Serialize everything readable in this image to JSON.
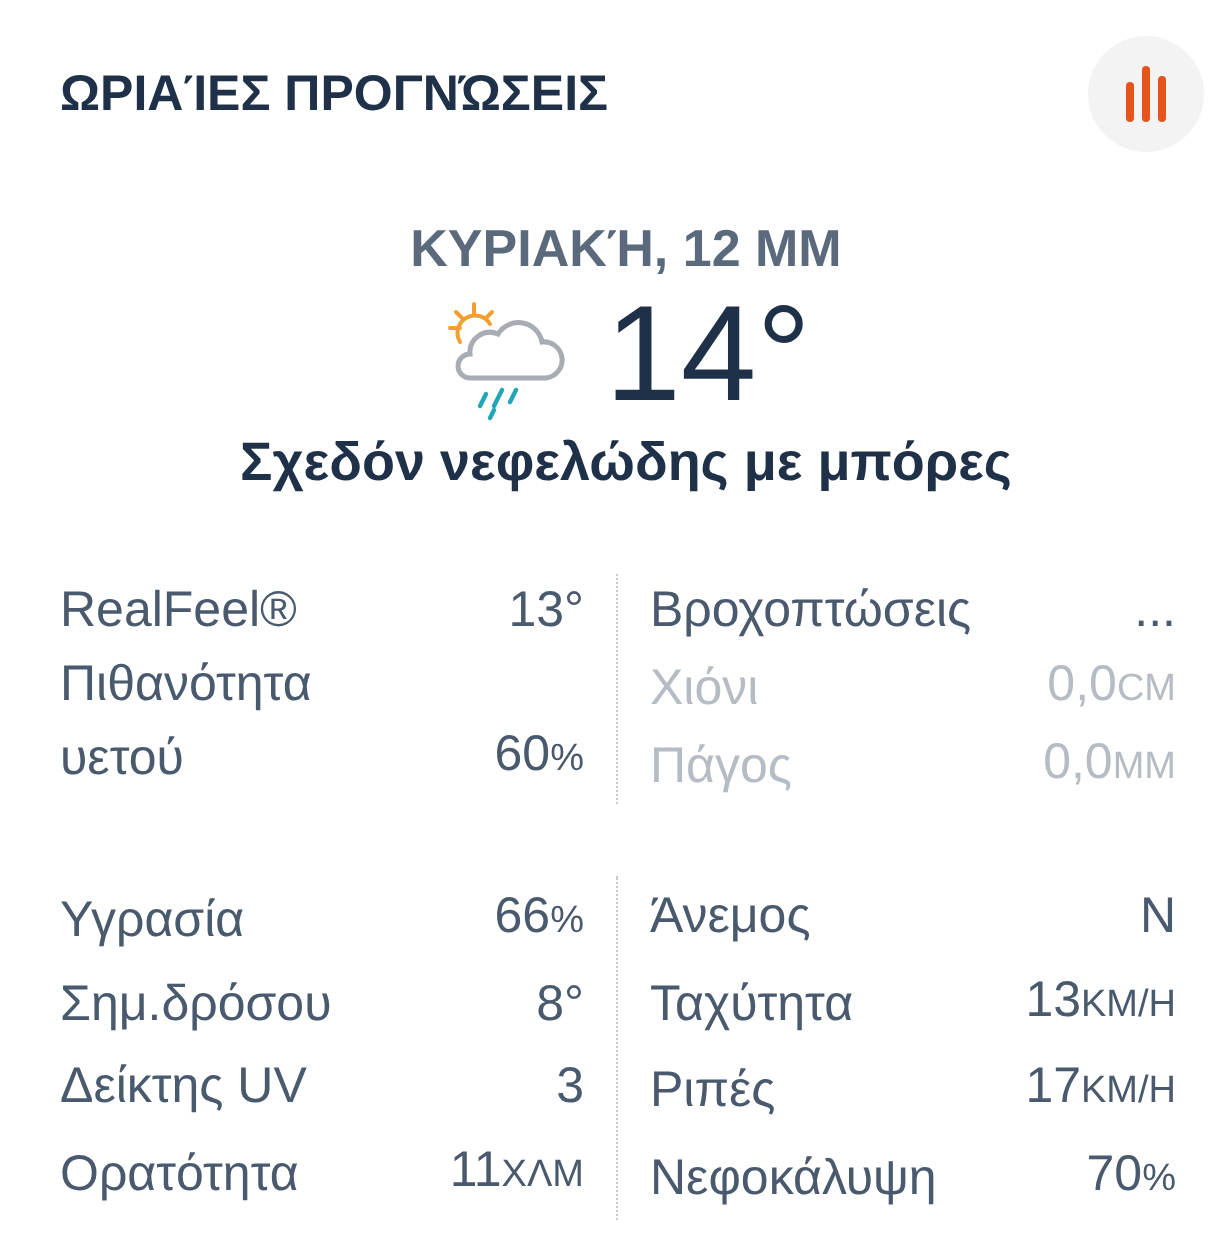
{
  "header": {
    "title": "ΩΡΙΑΊΕΣ ΠΡΟΓΝΏΣΕΙΣ"
  },
  "forecast": {
    "time": "ΚΥΡΙΑΚΉ, 12 ΜΜ",
    "temperature": "14°",
    "condition": "Σχεδόν νεφελώδης με μπόρες"
  },
  "sections": [
    {
      "left": [
        {
          "label": "RealFeel®",
          "value": "13°",
          "disabled": false
        },
        {
          "label": "Πιθανότητα υετού",
          "value": "60",
          "unit": "%",
          "disabled": false
        }
      ],
      "right": [
        {
          "label": "Βροχοπτώσεις",
          "value": "...",
          "disabled": false
        },
        {
          "label": "Χιόνι",
          "value": "0,0",
          "unit": "CM",
          "disabled": true
        },
        {
          "label": "Πάγος",
          "value": "0,0",
          "unit": "ΜΜ",
          "disabled": true
        }
      ]
    },
    {
      "left": [
        {
          "label": "Υγρασία",
          "value": "66",
          "unit": "%",
          "disabled": false
        },
        {
          "label": "Σημ.δρόσου",
          "value": "8°",
          "disabled": false
        },
        {
          "label": "Δείκτης UV",
          "value": "3",
          "disabled": false
        },
        {
          "label": "Ορατότητα",
          "value": "11",
          "unit": "ΧΛΜ",
          "disabled": false
        }
      ],
      "right": [
        {
          "label": "Άνεμος",
          "value": "N",
          "disabled": false
        },
        {
          "label": "Ταχύτητα",
          "value": "13",
          "unit": "ΚΜ/Η",
          "disabled": false
        },
        {
          "label": "Ριπές",
          "value": "17",
          "unit": "ΚΜ/Η",
          "disabled": false
        },
        {
          "label": "Νεφοκάλυψη",
          "value": "70",
          "unit": "%",
          "disabled": false
        }
      ]
    }
  ]
}
